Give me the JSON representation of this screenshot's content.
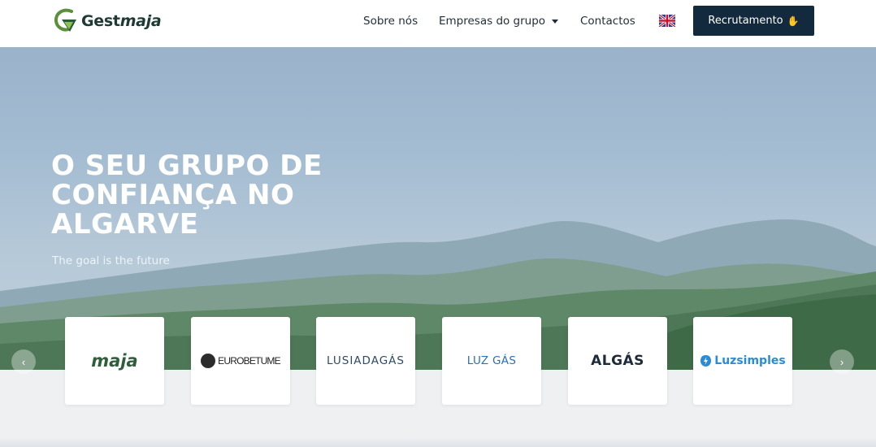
{
  "header": {
    "logo": {
      "text_regular": "Gest",
      "text_emphasis": "maja"
    },
    "nav": [
      {
        "label": "Sobre nós"
      },
      {
        "label": "Empresas do grupo"
      },
      {
        "label": "Contactos"
      }
    ],
    "language_flag": "uk-flag-icon",
    "recruit_button": {
      "label": "Recrutamento",
      "icon": "waving-hand-icon"
    }
  },
  "hero": {
    "title": "O SEU GRUPO DE CONFIANÇA NO ALGARVE",
    "subtitle": "The goal is the future"
  },
  "carousel": {
    "prev_icon": "‹",
    "next_icon": "›",
    "brands": [
      {
        "name": "maja"
      },
      {
        "name": "EUROBETUME"
      },
      {
        "name": "LUSIADAGÁS"
      },
      {
        "name": "LUZ GÁS"
      },
      {
        "name": "ALGÁS"
      },
      {
        "name": "Luzsimples"
      }
    ]
  },
  "colors": {
    "header_bg": "#ffffff",
    "button_bg": "#13293d",
    "text_dark": "#1f2d3a",
    "hero_sky": "#9ab3cb",
    "lower_bg": "#eef0f2"
  }
}
